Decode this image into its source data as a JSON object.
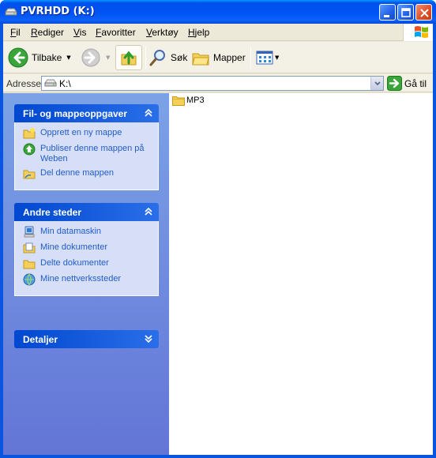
{
  "window": {
    "title": "PVRHDD (K:)"
  },
  "menu": {
    "items": [
      {
        "label": "Fil",
        "mnemonic": "F",
        "rest": "il"
      },
      {
        "label": "Rediger",
        "mnemonic": "R",
        "rest": "ediger"
      },
      {
        "label": "Vis",
        "mnemonic": "V",
        "rest": "is"
      },
      {
        "label": "Favoritter",
        "mnemonic": "F",
        "rest": "avoritter"
      },
      {
        "label": "Verktøy",
        "mnemonic": "V",
        "rest": "erktøy"
      },
      {
        "label": "Hjelp",
        "mnemonic": "H",
        "rest": "jelp"
      }
    ]
  },
  "toolbar": {
    "back_label": "Tilbake",
    "search_label": "Søk",
    "folders_label": "Mapper"
  },
  "address": {
    "label": "Adresse",
    "value": "K:\\",
    "go_label": "Gå til"
  },
  "taskpane": {
    "panels": [
      {
        "title": "Fil- og mappeoppgaver",
        "tasks": [
          {
            "label": "Opprett en ny mappe",
            "icon": "new-folder-icon"
          },
          {
            "label": "Publiser denne mappen på Weben",
            "icon": "publish-web-icon"
          },
          {
            "label": "Del denne mappen",
            "icon": "share-folder-icon"
          }
        ]
      },
      {
        "title": "Andre steder",
        "tasks": [
          {
            "label": "Min datamaskin",
            "icon": "my-computer-icon"
          },
          {
            "label": "Mine dokumenter",
            "icon": "my-documents-icon"
          },
          {
            "label": "Delte dokumenter",
            "icon": "shared-documents-icon"
          },
          {
            "label": "Mine nettverkssteder",
            "icon": "network-places-icon"
          }
        ]
      },
      {
        "title": "Detaljer",
        "tasks": []
      }
    ]
  },
  "files": [
    {
      "name": "MP3",
      "icon": "folder-icon"
    }
  ],
  "colors": {
    "titlebar": "#0054e3",
    "taskpane_bg": "#7ba2e7",
    "task_link": "#215dc6",
    "panel_body": "#d6dff7"
  }
}
